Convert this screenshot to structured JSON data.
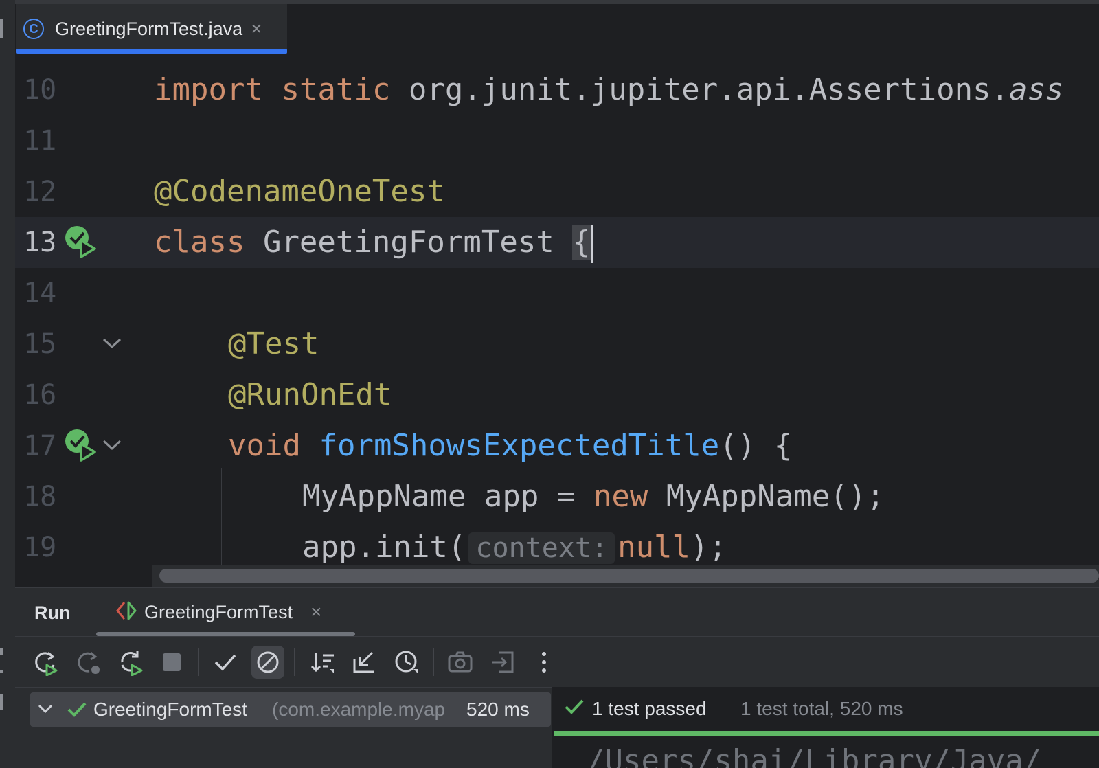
{
  "editor_tab": {
    "label": "GreetingFormTest.java",
    "icon": "class-icon",
    "icon_glyph": "C",
    "close": "×"
  },
  "editor": {
    "lines": [
      {
        "num": "10"
      },
      {
        "num": "11"
      },
      {
        "num": "12"
      },
      {
        "num": "13"
      },
      {
        "num": "14"
      },
      {
        "num": "15"
      },
      {
        "num": "16"
      },
      {
        "num": "17"
      },
      {
        "num": "18"
      },
      {
        "num": "19"
      }
    ],
    "code": {
      "l10_kw1": "import",
      "l10_kw2": "static",
      "l10_rest": "org.junit.jupiter.api.Assertions.",
      "l10_ital": "ass",
      "l12_ann": "@CodenameOneTest",
      "l13_kw": "class",
      "l13_name": "GreetingFormTest",
      "l13_brace": "{",
      "l15_ann": "@Test",
      "l16_ann": "@RunOnEdt",
      "l17_kw": "void",
      "l17_fn": "formShowsExpectedTitle",
      "l17_rest": "() {",
      "l18_type": "MyAppName app = ",
      "l18_kw": "new",
      "l18_rest": " MyAppName();",
      "l19_pre": "app.init(",
      "l19_hint": "context:",
      "l19_kw": "null",
      "l19_rest": ");"
    }
  },
  "run_panel": {
    "title": "Run",
    "config_tab": "GreetingFormTest",
    "close": "×",
    "toolbar": [
      "rerun-icon",
      "rerun-failed-icon",
      "toggle-auto-test-icon",
      "stop-icon",
      "show-passed-icon",
      "show-ignored-icon",
      "sort-icon",
      "collapse-icon",
      "test-history-icon",
      "screenshot-icon",
      "export-icon",
      "more-icon"
    ],
    "tree": {
      "name": "GreetingFormTest",
      "package": "(com.example.myap",
      "time": "520 ms"
    },
    "status": {
      "passed": "1 test passed",
      "total": "1 test total, 520 ms"
    },
    "console_partial": "/Users/shai/Library/Java/"
  },
  "colors": {
    "accent": "#3574f0",
    "success": "#5fb865",
    "keyword": "#cf8e6d",
    "annotation": "#b3ae60",
    "function": "#56a8f5"
  }
}
